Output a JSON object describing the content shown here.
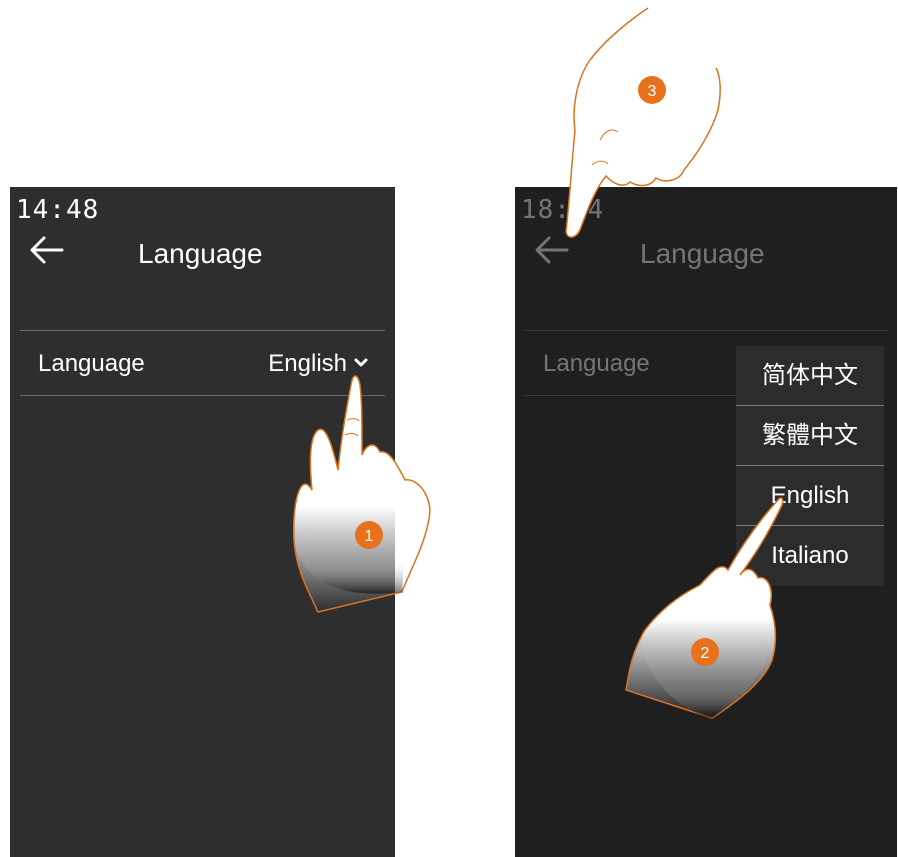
{
  "left_screen": {
    "time": "14:48",
    "title": "Language",
    "setting": {
      "label": "Language",
      "value": "English"
    }
  },
  "right_screen": {
    "time": "18:24",
    "title": "Language",
    "setting": {
      "label": "Language"
    },
    "menu": {
      "options": [
        "简体中文",
        "繁體中文",
        "English",
        "Italiano"
      ]
    }
  },
  "steps": [
    "1",
    "2",
    "3"
  ],
  "colors": {
    "accent_orange": "#e8721c",
    "hand_outline": "#d9731f",
    "screen_bg": "#2e2e2e",
    "screen_dim_bg": "#1f1f1f"
  },
  "icons": {
    "back": "arrow-left-icon",
    "dropdown": "chevron-down-icon",
    "pointer": "pointing-hand-icon"
  }
}
